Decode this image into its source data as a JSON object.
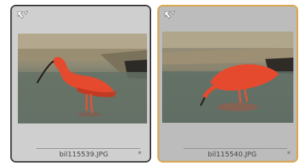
{
  "thumbnails": [
    {
      "filename": "bil115539.JPG",
      "marker": "*",
      "selected": false,
      "badge_icon": "check-flag-icon",
      "photo_subject": "scarlet-ibis-icon"
    },
    {
      "filename": "bil115540.JPG",
      "marker": "*",
      "selected": true,
      "badge_icon": "check-flag-icon",
      "photo_subject": "scarlet-ibis-icon"
    }
  ],
  "colors": {
    "selected_border": "#d9a850",
    "tile_bg": "#cfcfcf",
    "bird": "#e8452c"
  }
}
